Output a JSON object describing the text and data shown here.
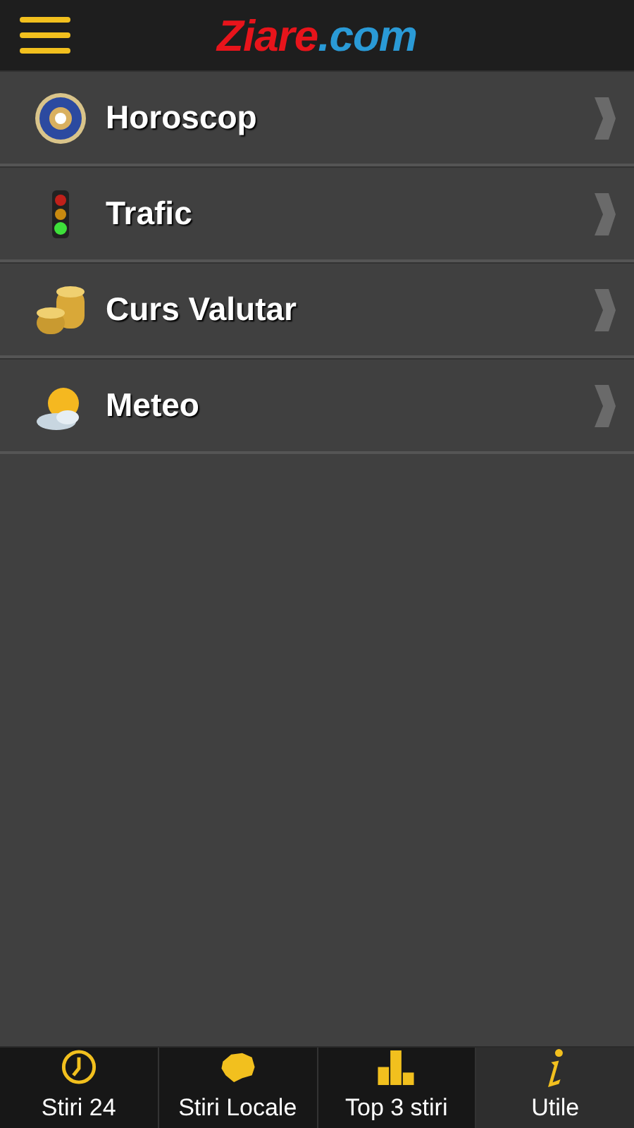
{
  "header": {
    "logo_main": "Ziare",
    "logo_suffix": ".com"
  },
  "menu_items": [
    {
      "label": "Horoscop"
    },
    {
      "label": "Trafic"
    },
    {
      "label": "Curs Valutar"
    },
    {
      "label": "Meteo"
    }
  ],
  "tabs": [
    {
      "label": "Stiri 24",
      "selected": false
    },
    {
      "label": "Stiri Locale",
      "selected": false
    },
    {
      "label": "Top 3 stiri",
      "selected": false
    },
    {
      "label": "Utile",
      "selected": true
    }
  ]
}
